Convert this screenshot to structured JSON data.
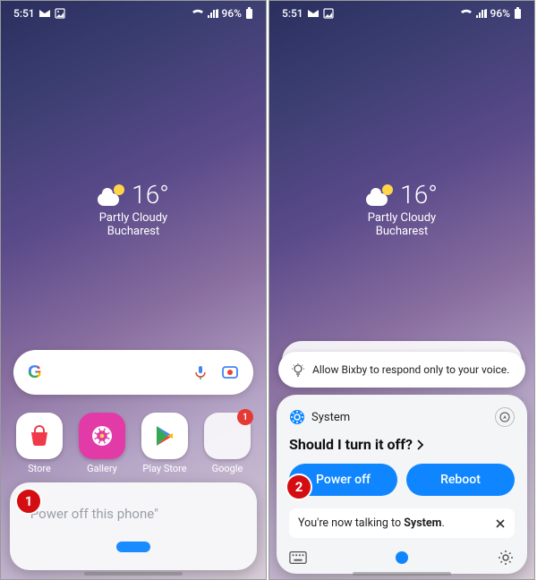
{
  "status": {
    "time": "5:51",
    "battery_pct": "96%"
  },
  "weather": {
    "temp": "16°",
    "condition": "Partly Cloudy",
    "city": "Bucharest"
  },
  "apps": {
    "store": "Store",
    "gallery": "Gallery",
    "playstore": "Play Store",
    "google": "Google",
    "google_badge": "1"
  },
  "bixby_left": {
    "quote": "\"Power off this phone\""
  },
  "bixby_right": {
    "tip": "Allow Bixby to respond only to your voice.",
    "system_label": "System",
    "title": "Should I turn it off?",
    "btn_power": "Power off",
    "btn_reboot": "Reboot",
    "talking_prefix": "You're now talking to ",
    "talking_target": "System",
    "talking_suffix": "."
  },
  "annotations": {
    "step1": "1",
    "step2": "2"
  }
}
